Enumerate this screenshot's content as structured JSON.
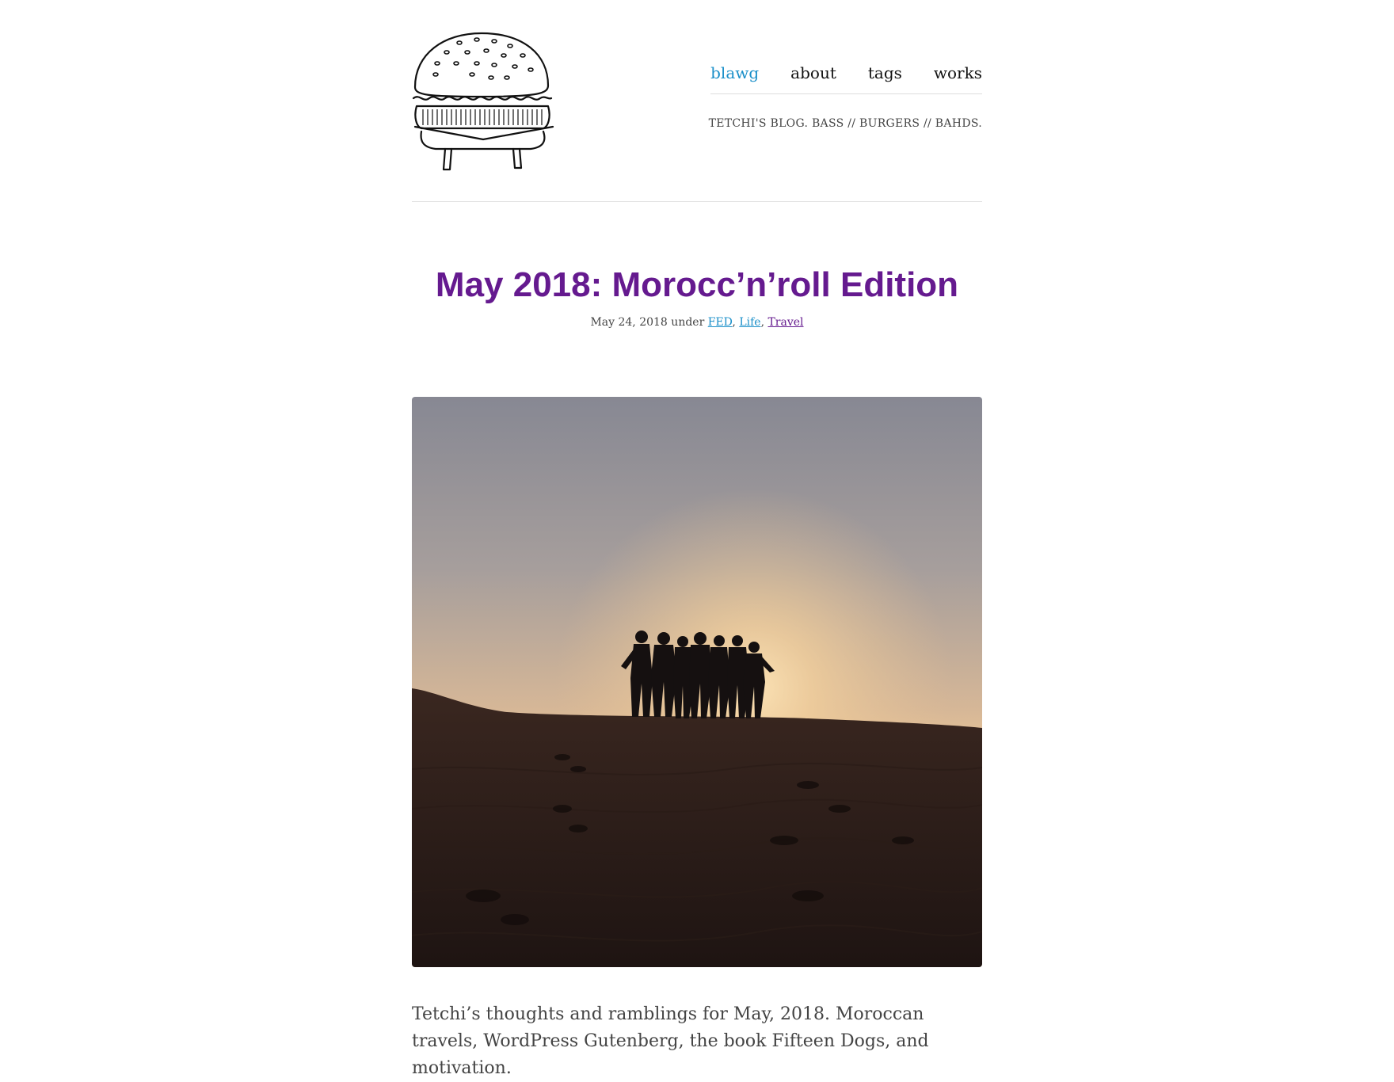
{
  "nav": {
    "items": [
      {
        "label": "blawg",
        "active": true
      },
      {
        "label": "about",
        "active": false
      },
      {
        "label": "tags",
        "active": false
      },
      {
        "label": "works",
        "active": false
      }
    ],
    "active_color": "#1a8fc9"
  },
  "site": {
    "tagline": "TETCHI'S BLOG. BASS // BURGERS // BAHDS.",
    "logo_icon": "burger-logo-icon"
  },
  "post": {
    "title": "May 2018: Morocc’n’roll Edition",
    "title_color": "#651a8f",
    "date": "May 24, 2018",
    "under_word": "under",
    "categories": [
      {
        "label": "FED"
      },
      {
        "label": "Life"
      },
      {
        "label": "Travel"
      }
    ],
    "hero_image_description": "silhouette of friends on sand dune at sunset",
    "intro": "Tetchi’s thoughts and ramblings for May, 2018. Moroccan travels, WordPress Gutenberg, the book Fifteen Dogs, and motivation."
  }
}
